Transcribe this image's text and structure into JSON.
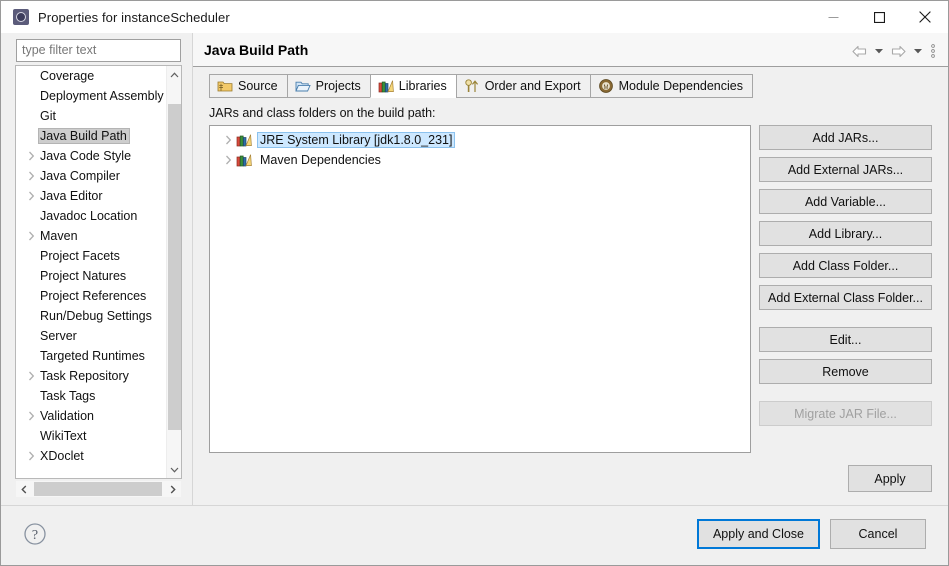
{
  "window": {
    "title": "Properties for instanceScheduler",
    "icon": "properties-gear-icon",
    "controls": {
      "minimize": "minimize-icon",
      "maximize": "maximize-icon",
      "close": "close-icon"
    }
  },
  "sidebar": {
    "filter": {
      "placeholder": "type filter text",
      "value": ""
    },
    "items": [
      {
        "label": "Coverage",
        "expandable": false,
        "selected": false
      },
      {
        "label": "Deployment Assembly",
        "expandable": false,
        "selected": false
      },
      {
        "label": "Git",
        "expandable": false,
        "selected": false
      },
      {
        "label": "Java Build Path",
        "expandable": false,
        "selected": true
      },
      {
        "label": "Java Code Style",
        "expandable": true,
        "selected": false
      },
      {
        "label": "Java Compiler",
        "expandable": true,
        "selected": false
      },
      {
        "label": "Java Editor",
        "expandable": true,
        "selected": false
      },
      {
        "label": "Javadoc Location",
        "expandable": false,
        "selected": false
      },
      {
        "label": "Maven",
        "expandable": true,
        "selected": false
      },
      {
        "label": "Project Facets",
        "expandable": false,
        "selected": false
      },
      {
        "label": "Project Natures",
        "expandable": false,
        "selected": false
      },
      {
        "label": "Project References",
        "expandable": false,
        "selected": false
      },
      {
        "label": "Run/Debug Settings",
        "expandable": false,
        "selected": false
      },
      {
        "label": "Server",
        "expandable": false,
        "selected": false
      },
      {
        "label": "Targeted Runtimes",
        "expandable": false,
        "selected": false
      },
      {
        "label": "Task Repository",
        "expandable": true,
        "selected": false
      },
      {
        "label": "Task Tags",
        "expandable": false,
        "selected": false
      },
      {
        "label": "Validation",
        "expandable": true,
        "selected": false
      },
      {
        "label": "WikiText",
        "expandable": false,
        "selected": false
      },
      {
        "label": "XDoclet",
        "expandable": true,
        "selected": false
      }
    ]
  },
  "panel": {
    "title": "Java Build Path",
    "nav": {
      "back": "back-arrow-icon",
      "back_menu": "chevron-down-icon",
      "forward": "forward-arrow-icon",
      "forward_menu": "chevron-down-icon",
      "view_menu": "vertical-dots-icon"
    },
    "tabs": [
      {
        "label": "Source",
        "icon": "source-folder-icon",
        "active": false
      },
      {
        "label": "Projects",
        "icon": "projects-folder-icon",
        "active": false
      },
      {
        "label": "Libraries",
        "icon": "libraries-books-icon",
        "active": true
      },
      {
        "label": "Order and Export",
        "icon": "order-export-icon",
        "active": false
      },
      {
        "label": "Module Dependencies",
        "icon": "module-circle-icon",
        "active": false
      }
    ],
    "list_caption": "JARs and class folders on the build path:",
    "libraries": [
      {
        "label": "JRE System Library [jdk1.8.0_231]",
        "icon": "library-books-icon",
        "expandable": true,
        "selected": true
      },
      {
        "label": "Maven Dependencies",
        "icon": "library-books-icon",
        "expandable": true,
        "selected": false
      }
    ],
    "buttons": [
      {
        "label": "Add JARs...",
        "enabled": true,
        "gap_before": false
      },
      {
        "label": "Add External JARs...",
        "enabled": true,
        "gap_before": false
      },
      {
        "label": "Add Variable...",
        "enabled": true,
        "gap_before": false
      },
      {
        "label": "Add Library...",
        "enabled": true,
        "gap_before": false
      },
      {
        "label": "Add Class Folder...",
        "enabled": true,
        "gap_before": false
      },
      {
        "label": "Add External Class Folder...",
        "enabled": true,
        "gap_before": false
      },
      {
        "label": "Edit...",
        "enabled": true,
        "gap_before": true
      },
      {
        "label": "Remove",
        "enabled": true,
        "gap_before": false
      },
      {
        "label": "Migrate JAR File...",
        "enabled": false,
        "gap_before": true
      }
    ],
    "apply_label": "Apply"
  },
  "footer": {
    "help_icon": "help-question-icon",
    "apply_and_close_label": "Apply and Close",
    "cancel_label": "Cancel"
  },
  "colors": {
    "accent": "#0078d7",
    "selection_tree": "#cde8ff",
    "selection_sidebar": "#cdcdcd",
    "panel_bg": "#f0f0f0",
    "button_face": "#e1e1e1"
  }
}
